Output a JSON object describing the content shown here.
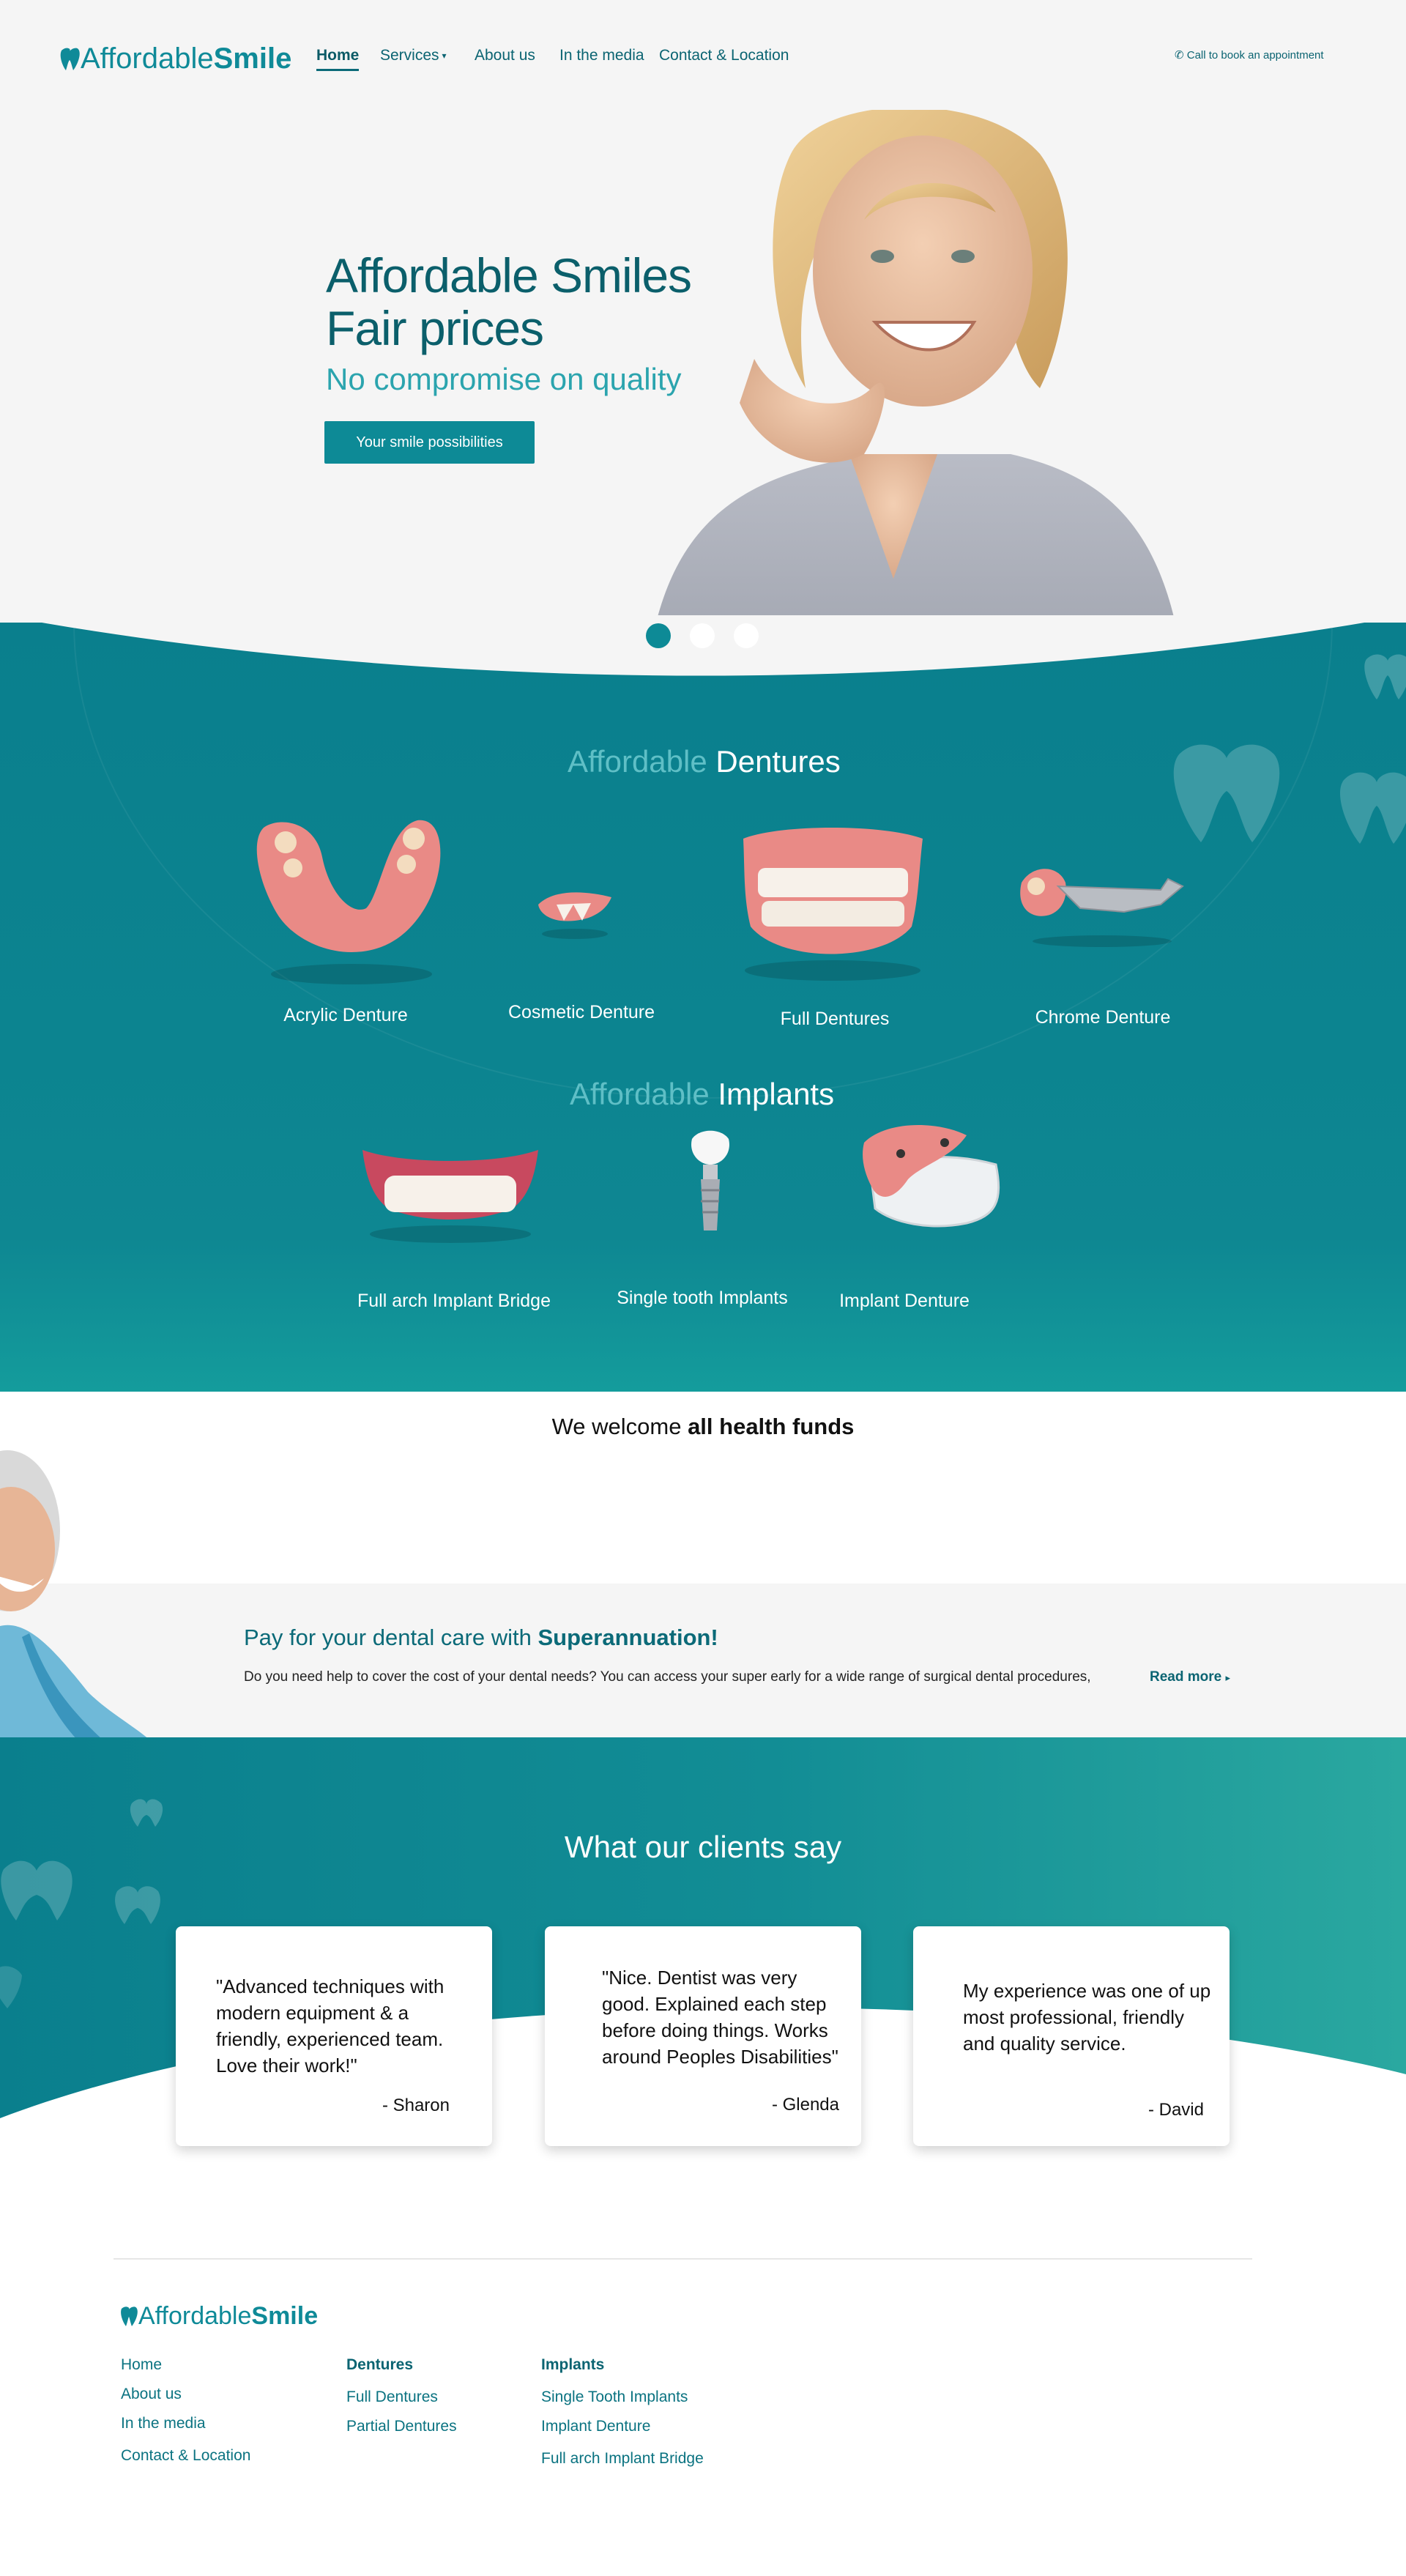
{
  "brand": {
    "name_light": "Affordable",
    "name_bold": "Smile",
    "color": "#0f8a98"
  },
  "nav": {
    "items": [
      {
        "label": "Home",
        "active": true
      },
      {
        "label": "Services",
        "has_dropdown": true
      },
      {
        "label": "About us"
      },
      {
        "label": "In the media"
      },
      {
        "label": "Contact & Location"
      }
    ],
    "phone_cta": "Call to book an appointment",
    "phone_icon": "phone-icon"
  },
  "hero": {
    "line1": "Affordable Smiles",
    "line2": "Fair prices",
    "subline": "No compromise on quality",
    "button": "Your smile possibilities",
    "slides": 3,
    "active_slide": 1
  },
  "dentures": {
    "title_light": "Affordable",
    "title_strong": "Dentures",
    "items": [
      "Acrylic Denture",
      "Cosmetic Denture",
      "Full Dentures",
      "Chrome Denture"
    ]
  },
  "implants": {
    "title_light": "Affordable",
    "title_strong": "Implants",
    "items": [
      "Full arch Implant Bridge",
      "Single tooth Implants",
      "Implant Denture"
    ]
  },
  "funds": {
    "text": "We welcome",
    "bold": "all health funds"
  },
  "superannuation": {
    "title": "Pay for your dental care with",
    "title_bold": "Superannuation!",
    "text": "Do you need help to cover the cost of your dental needs? You can access your super early for a wide range of surgical dental procedures,",
    "read_more": "Read more"
  },
  "testimonials": {
    "title": "What our clients say",
    "items": [
      {
        "quote": "\"Advanced techniques with modern equipment & a friendly, experienced team. Love their work!\"",
        "author": "- Sharon"
      },
      {
        "quote": "\"Nice. Dentist was very good. Explained each step before doing things. Works around Peoples Disabilities\"",
        "author": "- Glenda"
      },
      {
        "quote": "My experience was one of up most professional, friendly and quality service.",
        "author": "- David"
      }
    ]
  },
  "footer": {
    "col1": [
      "Home",
      "About us",
      "In the media",
      "Contact & Location"
    ],
    "col2_head": "Dentures",
    "col2": [
      "Full Dentures",
      "Partial Dentures"
    ],
    "col3_head": "Implants",
    "col3": [
      "Single Tooth Implants",
      "Implant Denture",
      "Full arch Implant Bridge"
    ]
  },
  "colors": {
    "teal_dark": "#0a7f8d",
    "teal_light": "#2aa8a0",
    "text_dark": "#0b5f6b"
  }
}
